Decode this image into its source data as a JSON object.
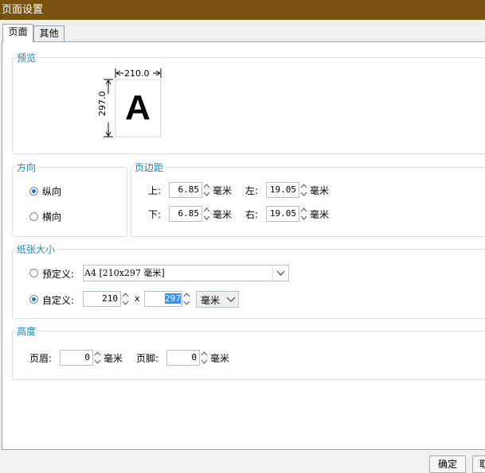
{
  "window": {
    "title": "页面设置"
  },
  "tabs": [
    {
      "label": "页面"
    },
    {
      "label": "其他"
    }
  ],
  "preview": {
    "label": "预览",
    "width_value": "210.0",
    "height_value": "297.0",
    "sample_letter": "A"
  },
  "orientation": {
    "label": "方向",
    "portrait": "纵向",
    "landscape": "横向",
    "selected": "portrait"
  },
  "margins": {
    "label": "页边距",
    "top": {
      "label": "上:",
      "value": "6.85",
      "unit": "毫米"
    },
    "bottom": {
      "label": "下:",
      "value": "6.85",
      "unit": "毫米"
    },
    "left": {
      "label": "左:",
      "value": "19.05",
      "unit": "毫米"
    },
    "right": {
      "label": "右:",
      "value": "19.05",
      "unit": "毫米"
    }
  },
  "paper": {
    "label": "纸张大小",
    "predefined": {
      "label": "预定义:",
      "value": "A4 [210x297 毫米]"
    },
    "custom": {
      "label": "自定义:",
      "width": "210",
      "separator": "x",
      "height": "297",
      "unit": "毫米"
    },
    "selected": "custom"
  },
  "height_section": {
    "label": "高度",
    "header": {
      "label": "页眉:",
      "value": "0",
      "unit": "毫米"
    },
    "footer": {
      "label": "页脚:",
      "value": "0",
      "unit": "毫米"
    }
  },
  "buttons": {
    "ok": "确定",
    "cancel": "取"
  }
}
